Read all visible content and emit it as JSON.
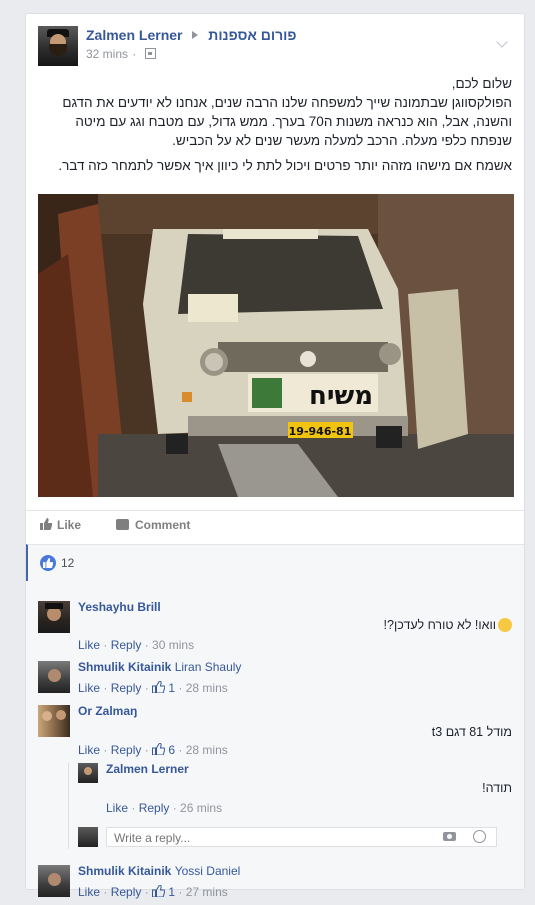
{
  "post": {
    "author": "Zalmen Lerner",
    "group": "פורום אספנות",
    "time": "32 mins",
    "paragraphs": [
      "שלום לכם,",
      "הפולקסווגן שבתמונה שייך למשפחה שלנו הרבה שנים, אנחנו לא יודעים את הדגם והשנה, אבל, הוא כנראה משנות ה70 בערך. ממש גדול, עם מטבח וגג עם מיטה שנפתח כלפי מעלה. הרכב למעלה מעשר שנים לא על הכביש.",
      "אשמח אם מישהו מזהה יותר פרטים ויכול לתת לי כיוון איך אפשר לתמחר כזה דבר."
    ],
    "photo_plate_text": "משיח",
    "photo_license": "19-946-81"
  },
  "actions": {
    "like": "Like",
    "comment": "Comment"
  },
  "likes_count": "12",
  "comments": [
    {
      "name": "Yeshayhu Brill",
      "tag": "",
      "text": "וואו! לא טורח לעדכן?!",
      "like": "Like",
      "reply": "Reply",
      "likes": "",
      "time": "30 mins"
    },
    {
      "name": "Shmulik Kitainik",
      "tag": "Liran Shauly",
      "text": "",
      "like": "Like",
      "reply": "Reply",
      "likes": "1",
      "time": "28 mins"
    },
    {
      "name": "Or Zalmaŋ",
      "tag": "",
      "text": "מודל 81 דגם t3",
      "like": "Like",
      "reply": "Reply",
      "likes": "6",
      "time": "28 mins"
    },
    {
      "name": "Zalmen Lerner",
      "tag": "",
      "text": "תודה!",
      "like": "Like",
      "reply": "Reply",
      "likes": "",
      "time": "26 mins"
    },
    {
      "name": "Shmulik Kitainik",
      "tag": "Yossi Daniel",
      "text": "",
      "like": "Like",
      "reply": "Reply",
      "likes": "1",
      "time": "27 mins"
    }
  ],
  "reply_placeholder": "Write a reply...",
  "colors": {
    "link": "#365899",
    "accent": "#4267b2",
    "meta": "#90949c"
  }
}
